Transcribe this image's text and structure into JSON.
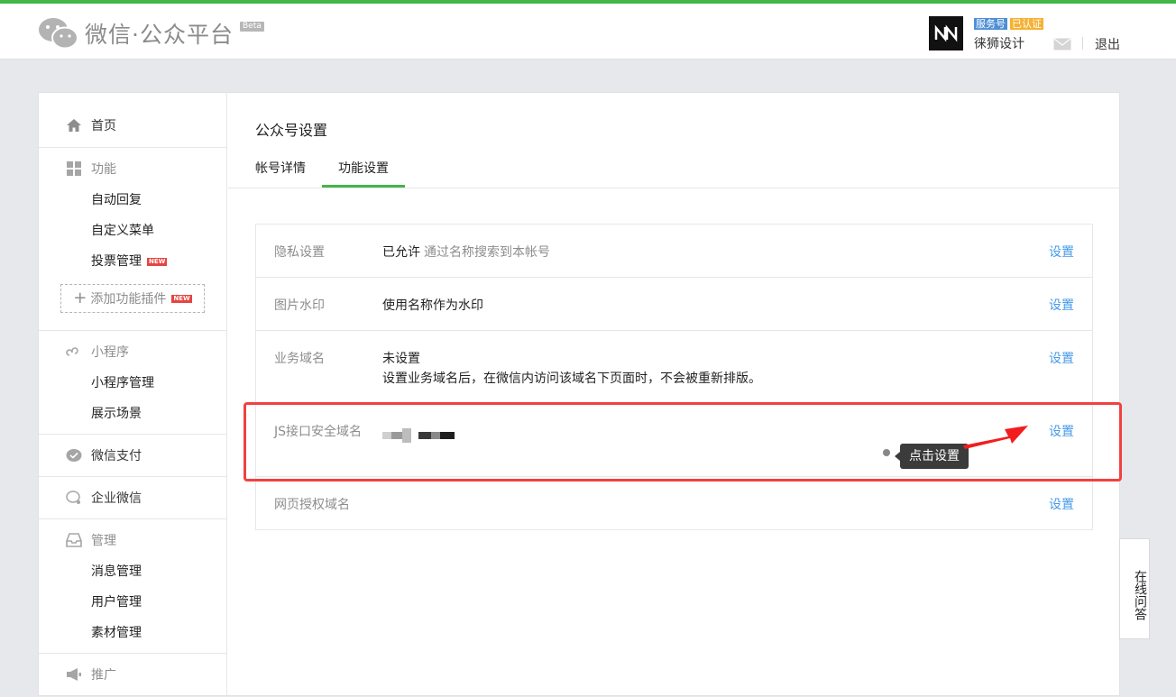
{
  "header": {
    "title": "微信·公众平台",
    "beta": "Beta",
    "account": {
      "badge_service": "服务号",
      "badge_verified": "已认证",
      "name": "徕狮设计",
      "logout": "退出"
    }
  },
  "sidebar": {
    "home": "首页",
    "feature": {
      "title": "功能",
      "items": [
        "自动回复",
        "自定义菜单",
        "投票管理"
      ],
      "new_tag": "NEW",
      "add_plugin": "添加功能插件"
    },
    "miniprogram": {
      "title": "小程序",
      "items": [
        "小程序管理",
        "展示场景"
      ]
    },
    "pay": "微信支付",
    "work": "企业微信",
    "manage": {
      "title": "管理",
      "items": [
        "消息管理",
        "用户管理",
        "素材管理"
      ]
    },
    "promote": "推广"
  },
  "main": {
    "page_title": "公众号设置",
    "tabs": [
      "帐号详情",
      "功能设置"
    ],
    "rows": [
      {
        "label": "隐私设置",
        "value": "已允许",
        "hint": "通过名称搜索到本帐号",
        "action": "设置"
      },
      {
        "label": "图片水印",
        "value": "使用名称作为水印",
        "action": "设置"
      },
      {
        "label": "业务域名",
        "value": "未设置",
        "hint": "设置业务域名后，在微信内访问该域名下页面时，不会被重新排版。",
        "action": "设置"
      },
      {
        "label": "JS接口安全域名",
        "action": "设置"
      },
      {
        "label": "网页授权域名",
        "action": "设置"
      }
    ],
    "tooltip": "点击设置"
  },
  "online_help": "在线问答",
  "colors": {
    "accent": "#44b549",
    "link": "#459ae9",
    "highlight": "#f24141"
  }
}
